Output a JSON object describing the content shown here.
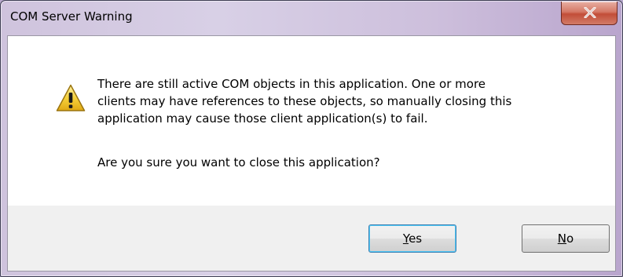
{
  "window": {
    "title": "COM Server Warning"
  },
  "icons": {
    "warning": "warning-icon",
    "close": "close-icon"
  },
  "message": {
    "line1": "There are still active COM objects in this application.  One or more",
    "line2": "clients may have references to these objects, so manually closing this",
    "line3": "application may cause those client application(s) to fail.",
    "question": "Are you sure you want to close this application?"
  },
  "buttons": {
    "yes": {
      "accel": "Y",
      "rest": "es"
    },
    "no": {
      "accel": "N",
      "rest": "o"
    }
  },
  "colors": {
    "close_button": "#c24d38",
    "default_button_border": "#3c7fb1",
    "warning_yellow": "#f6d23c"
  }
}
